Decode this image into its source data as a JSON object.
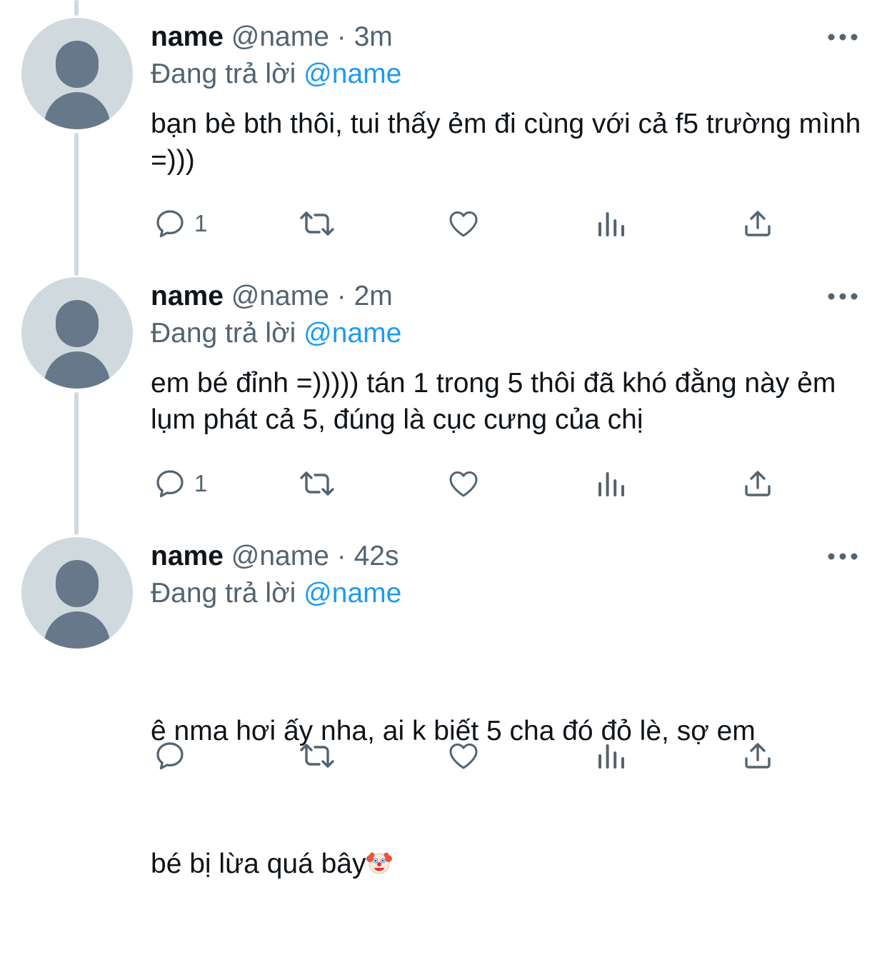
{
  "tweets": [
    {
      "name": "name",
      "handle": "@name",
      "separator": "·",
      "time": "3m",
      "replying_prefix": "Đang trả lời",
      "replying_to": "@name",
      "text": "bạn bè bth thôi, tui thấy ẻm đi cùng với cả f5 trường mình =)))",
      "reply_count": "1",
      "retweet_count": "",
      "like_count": ""
    },
    {
      "name": "name",
      "handle": "@name",
      "separator": "·",
      "time": "2m",
      "replying_prefix": "Đang trả lời",
      "replying_to": "@name",
      "text": "em bé đỉnh =))))) tán 1 trong 5 thôi đã khó đằng này ẻm lụm phát cả 5, đúng là cục cưng của chị",
      "reply_count": "1",
      "retweet_count": "",
      "like_count": ""
    },
    {
      "name": "name",
      "handle": "@name",
      "separator": "·",
      "time": "42s",
      "replying_prefix": "Đang trả lời",
      "replying_to": "@name",
      "text_line1": "ê nma hơi ấy nha, ai k biết 5 cha đó đỏ lè, sợ em",
      "text_line2": "bé bị lừa quá bây",
      "emoji": "clown-face-emoji",
      "reply_count": "",
      "retweet_count": "",
      "like_count": ""
    }
  ],
  "icons": {
    "reply": "reply-icon",
    "retweet": "retweet-icon",
    "like": "like-icon",
    "views": "views-icon",
    "share": "share-icon",
    "more": "more-icon"
  },
  "colors": {
    "text": "#0f1419",
    "secondary": "#536471",
    "mention": "#1d9bf0",
    "thread_line": "#cfd9de",
    "avatar_bg": "#cfd9de",
    "avatar_fg": "#66788a"
  }
}
